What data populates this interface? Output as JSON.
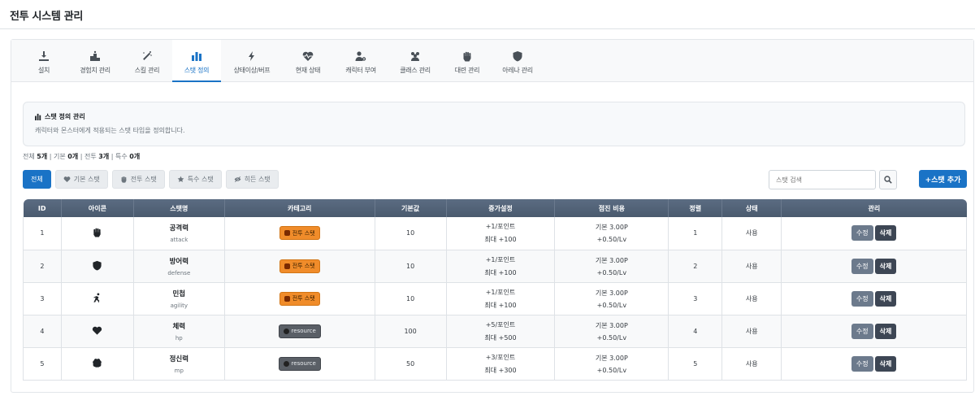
{
  "page_title": "전투 시스템 관리",
  "tabs": [
    {
      "label": "설치",
      "icon": "download-icon",
      "active": false
    },
    {
      "label": "경험치 관리",
      "icon": "ranking-icon",
      "active": false
    },
    {
      "label": "스킬 관리",
      "icon": "magic-wand-icon",
      "active": false
    },
    {
      "label": "스탯 정의",
      "icon": "bar-chart-icon",
      "active": true
    },
    {
      "label": "상태이상/버프",
      "icon": "bolt-icon",
      "active": false
    },
    {
      "label": "현재 상태",
      "icon": "heartbeat-icon",
      "active": false
    },
    {
      "label": "캐릭터 부여",
      "icon": "user-gear-icon",
      "active": false
    },
    {
      "label": "클래스 관리",
      "icon": "users-icon",
      "active": false
    },
    {
      "label": "대련 관리",
      "icon": "fist-icon",
      "active": false
    },
    {
      "label": "아레나 관리",
      "icon": "shield-icon",
      "active": false
    }
  ],
  "info": {
    "title": "스탯 정의 관리",
    "description": "캐릭터와 몬스터에게 적용되는 스탯 타입을 정의합니다."
  },
  "counts": {
    "total_label": "전체",
    "total": "5개",
    "basic_label": "기본",
    "basic": "0개",
    "combat_label": "전투",
    "combat": "3개",
    "special_label": "특수",
    "special": "0개"
  },
  "filters": [
    {
      "label": "전체",
      "icon": "",
      "active": true
    },
    {
      "label": "기본 스탯",
      "icon": "heart-icon",
      "active": false
    },
    {
      "label": "전투 스탯",
      "icon": "fist-icon",
      "active": false
    },
    {
      "label": "특수 스탯",
      "icon": "star-icon",
      "active": false
    },
    {
      "label": "히든 스탯",
      "icon": "eye-slash-icon",
      "active": false
    }
  ],
  "search": {
    "placeholder": "스탯 검색"
  },
  "add_button": "+스탯 추가",
  "table": {
    "headers": [
      "ID",
      "아이콘",
      "스탯명",
      "카테고리",
      "기본값",
      "증가설정",
      "점진 비용",
      "정렬",
      "상태",
      "관리"
    ],
    "edit_label": "수정",
    "delete_label": "삭제",
    "rows": [
      {
        "id": "1",
        "icon": "fist-icon",
        "name": "공격력",
        "key": "attack",
        "category": "전투 스탯",
        "category_type": "combat",
        "base": "10",
        "inc1": "+1/포인트",
        "inc2": "최대 +100",
        "cost1": "기본 3.00P",
        "cost2": "+0.50/Lv",
        "order": "1",
        "status": "사용"
      },
      {
        "id": "2",
        "icon": "shield-icon",
        "name": "방어력",
        "key": "defense",
        "category": "전투 스탯",
        "category_type": "combat",
        "base": "10",
        "inc1": "+1/포인트",
        "inc2": "최대 +100",
        "cost1": "기본 3.00P",
        "cost2": "+0.50/Lv",
        "order": "2",
        "status": "사용"
      },
      {
        "id": "3",
        "icon": "running-icon",
        "name": "민첩",
        "key": "agility",
        "category": "전투 스탯",
        "category_type": "combat",
        "base": "10",
        "inc1": "+1/포인트",
        "inc2": "최대 +100",
        "cost1": "기본 3.00P",
        "cost2": "+0.50/Lv",
        "order": "3",
        "status": "사용"
      },
      {
        "id": "4",
        "icon": "heart-icon",
        "name": "체력",
        "key": "hp",
        "category": "resource",
        "category_type": "resource",
        "base": "100",
        "inc1": "+5/포인트",
        "inc2": "최대 +500",
        "cost1": "기본 3.00P",
        "cost2": "+0.50/Lv",
        "order": "4",
        "status": "사용"
      },
      {
        "id": "5",
        "icon": "brain-icon",
        "name": "정신력",
        "key": "mp",
        "category": "resource",
        "category_type": "resource",
        "base": "50",
        "inc1": "+3/포인트",
        "inc2": "최대 +300",
        "cost1": "기본 3.00P",
        "cost2": "+0.50/Lv",
        "order": "5",
        "status": "사용"
      }
    ]
  }
}
